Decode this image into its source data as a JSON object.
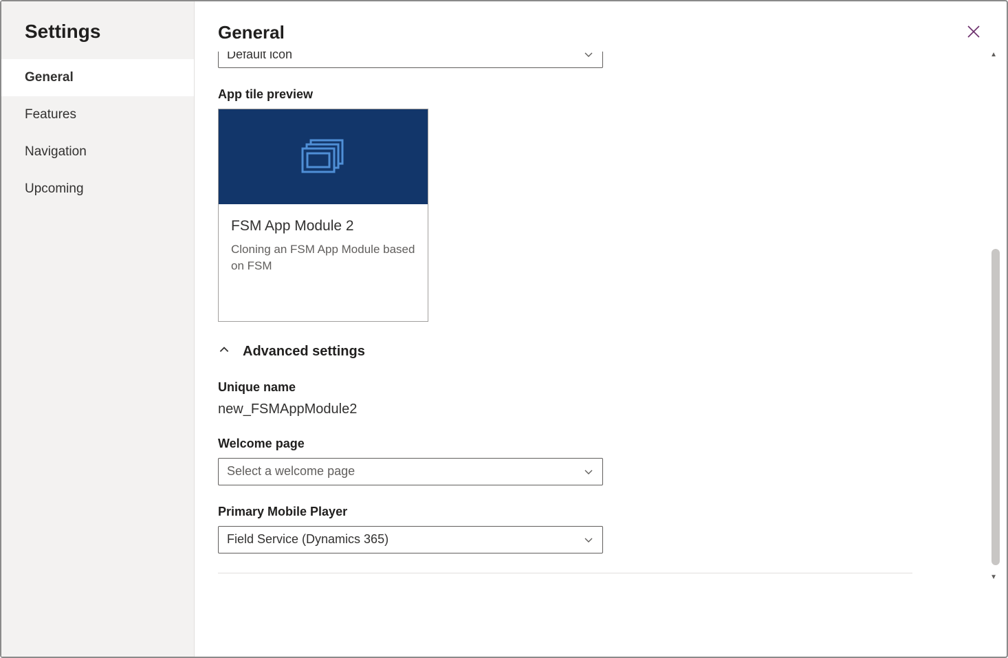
{
  "sidebar": {
    "title": "Settings",
    "items": [
      {
        "label": "General",
        "active": true
      },
      {
        "label": "Features",
        "active": false
      },
      {
        "label": "Navigation",
        "active": false
      },
      {
        "label": "Upcoming",
        "active": false
      }
    ]
  },
  "header": {
    "title": "General"
  },
  "icon_select": {
    "value": "Default icon"
  },
  "tile_preview": {
    "label": "App tile preview",
    "title": "FSM App Module 2",
    "description": "Cloning an FSM App Module based on FSM"
  },
  "advanced": {
    "header": "Advanced settings",
    "unique_name_label": "Unique name",
    "unique_name_value": "new_FSMAppModule2",
    "welcome_label": "Welcome page",
    "welcome_placeholder": "Select a welcome page",
    "mobile_label": "Primary Mobile Player",
    "mobile_value": "Field Service (Dynamics 365)"
  }
}
